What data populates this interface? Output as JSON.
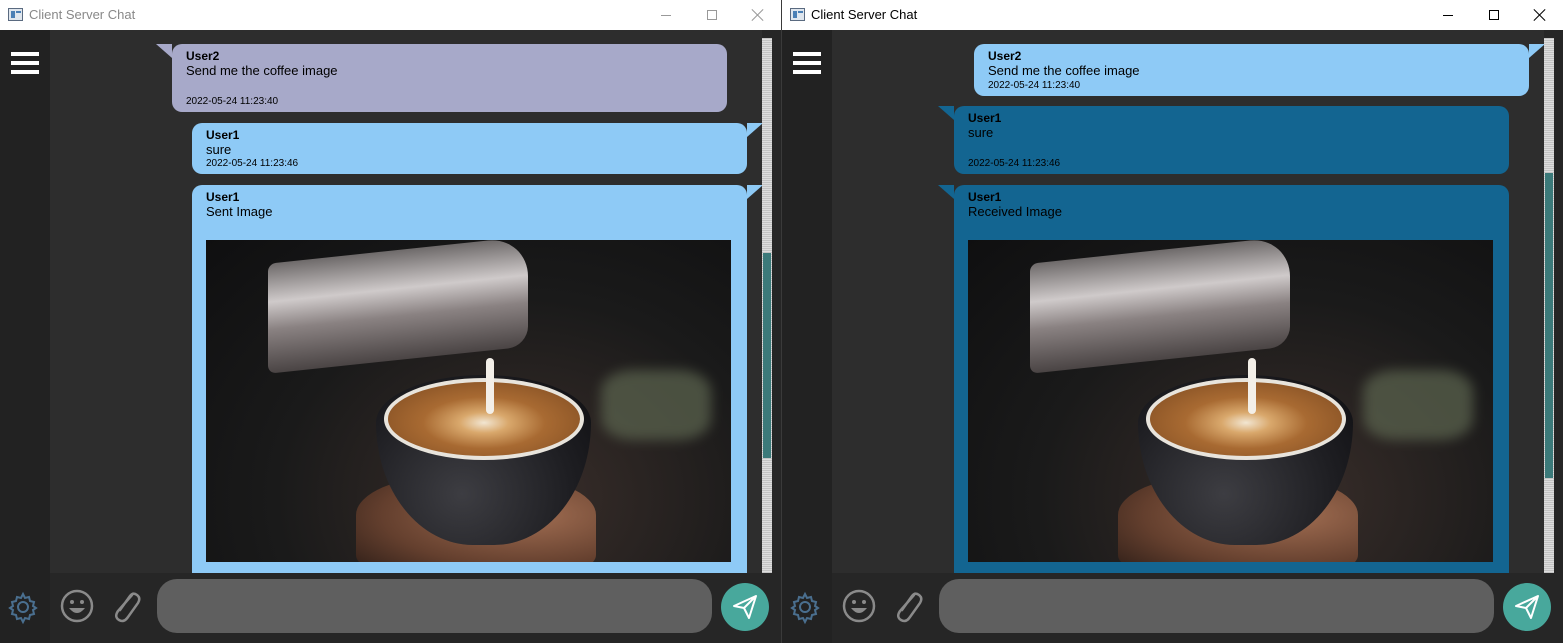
{
  "colors": {
    "title_bg": "#ffffff",
    "sidebar_bg": "#222222",
    "chat_bg": "#2d2d2d",
    "bubble_user2_gray": "#a7a9c9",
    "bubble_light_blue": "#8ecaf6",
    "bubble_dark_blue": "#136591",
    "input_bg": "#5f5f5f",
    "send_button": "#48a89c",
    "scroll_thumb": "#3c7a7a"
  },
  "icons": {
    "menu": "hamburger-menu-icon",
    "settings": "gear-icon",
    "emoji": "smiley-icon",
    "attach": "paperclip-icon",
    "send": "paper-plane-icon",
    "app": "window-app-icon"
  },
  "windows": {
    "left": {
      "title": "Client Server Chat",
      "input_placeholder": "",
      "messages": [
        {
          "sender": "User2",
          "text": "Send me the coffee image",
          "time": "2022-05-24 11:23:40"
        },
        {
          "sender": "User1",
          "text": "sure",
          "time": "2022-05-24 11:23:46"
        },
        {
          "sender": "User1",
          "text": "Sent Image",
          "image": "latte-art-coffee-photo"
        }
      ]
    },
    "right": {
      "title": "Client Server Chat",
      "input_placeholder": "",
      "messages": [
        {
          "sender": "User2",
          "text": "Send me the coffee image",
          "time": "2022-05-24 11:23:40"
        },
        {
          "sender": "User1",
          "text": "sure",
          "time": "2022-05-24 11:23:46"
        },
        {
          "sender": "User1",
          "text": "Received Image",
          "image": "latte-art-coffee-photo"
        }
      ]
    }
  }
}
